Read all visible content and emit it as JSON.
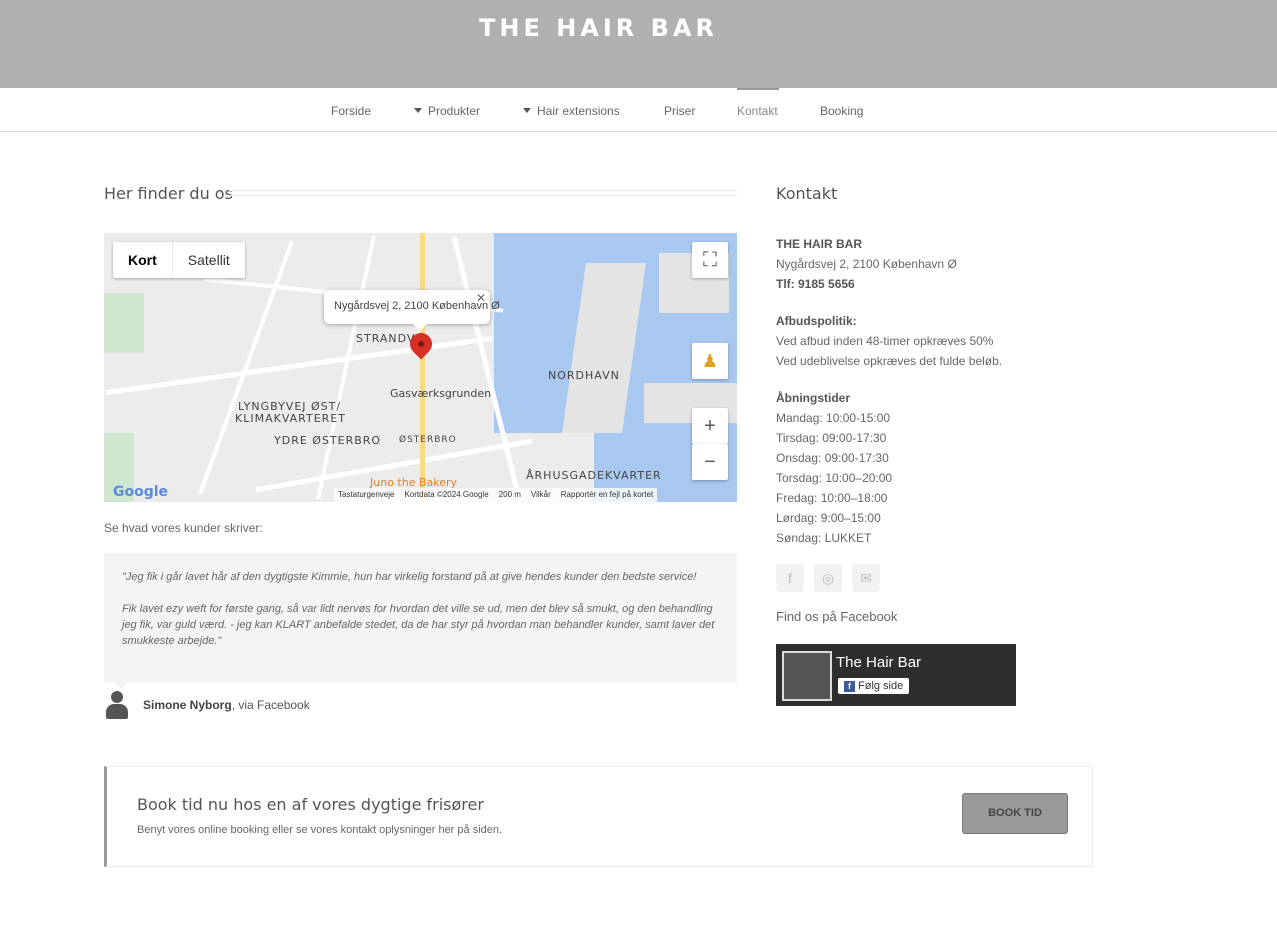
{
  "header": {
    "logo": "THE HAIR BAR"
  },
  "nav": {
    "items": [
      {
        "label": "Forside"
      },
      {
        "label": "Produkter"
      },
      {
        "label": "Hair extensions"
      },
      {
        "label": "Priser"
      },
      {
        "label": "Kontakt"
      },
      {
        "label": "Booking"
      }
    ],
    "active": "Kontakt"
  },
  "map_section": {
    "title": "Her finder du os",
    "tabs": [
      "Kort",
      "Satellit"
    ],
    "popup": "Nygårdsvej 2, 2100 København Ø",
    "labels": {
      "strand": "STRANDV",
      "gasvaerk": "Gasværksgrunden",
      "nordhavn": "NORDHAVN",
      "lyngby": "LYNGBYVEJ ØST/",
      "klimak": "KLIMAKVARTERET",
      "ydre": "YDRE ØSTERBRO",
      "osterbro": "ØSTERBRO",
      "aarhus": "ÅRHUSGADEKVARTER",
      "bakery": "Juno the Bakery"
    },
    "google": "Google",
    "footer": [
      "Tastaturgenveje",
      "Kortdata ©2024 Google",
      "200 m",
      "Vilkår",
      "Rapportér en fejl på kortet"
    ]
  },
  "customers": {
    "lead": "Se hvad vores kunder skriver:",
    "quote_p1": "\"Jeg fik i går lavet hår af den dygtigste Kimmie, hun har virkelig forstand på at give hendes kunder den bedste service!",
    "quote_p2": "Fik lavet ezy weft for første gang, så var lidt nervøs for hvordan det ville se ud, men det blev så smukt, og den behandling jeg fik, var guld værd. - jeg kan KLART anbefalde stedet, da de har styr på hvordan man behandler kunder, samt laver det smukkeste arbejde.\"",
    "author_name": "Simone Nyborg",
    "author_via": ", via Facebook"
  },
  "contact": {
    "title": "Kontakt",
    "name": "THE HAIR BAR",
    "address": "Nygårdsvej 2, 2100 København Ø",
    "phone_label": "Tlf:",
    "phone": "9185 5656",
    "policy_title": "Afbudspolitik:",
    "policy_1": "Ved afbud inden 48-timer opkræves 50%",
    "policy_2": "Ved udeblivelse opkræves det fulde beløb.",
    "hours_title": "Åbningstider",
    "hours": [
      "Mandag: 10:00-15:00",
      "Tirsdag: 09:00-17:30",
      "Onsdag: 09:00-17:30",
      "Torsdag: 10:00–20:00",
      "Fredag: 10:00–18:00",
      "Lørdag: 9:00–15:00",
      "Søndag: LUKKET"
    ],
    "find_fb": "Find os på Facebook",
    "fb_page": "The Hair Bar",
    "fb_follow": "Følg side"
  },
  "cta": {
    "title": "Book tid nu hos en af vores dygtige frisører",
    "subtitle": "Benyt vores online booking eller se vores kontakt oplysninger her på siden.",
    "button": "BOOK TID"
  }
}
